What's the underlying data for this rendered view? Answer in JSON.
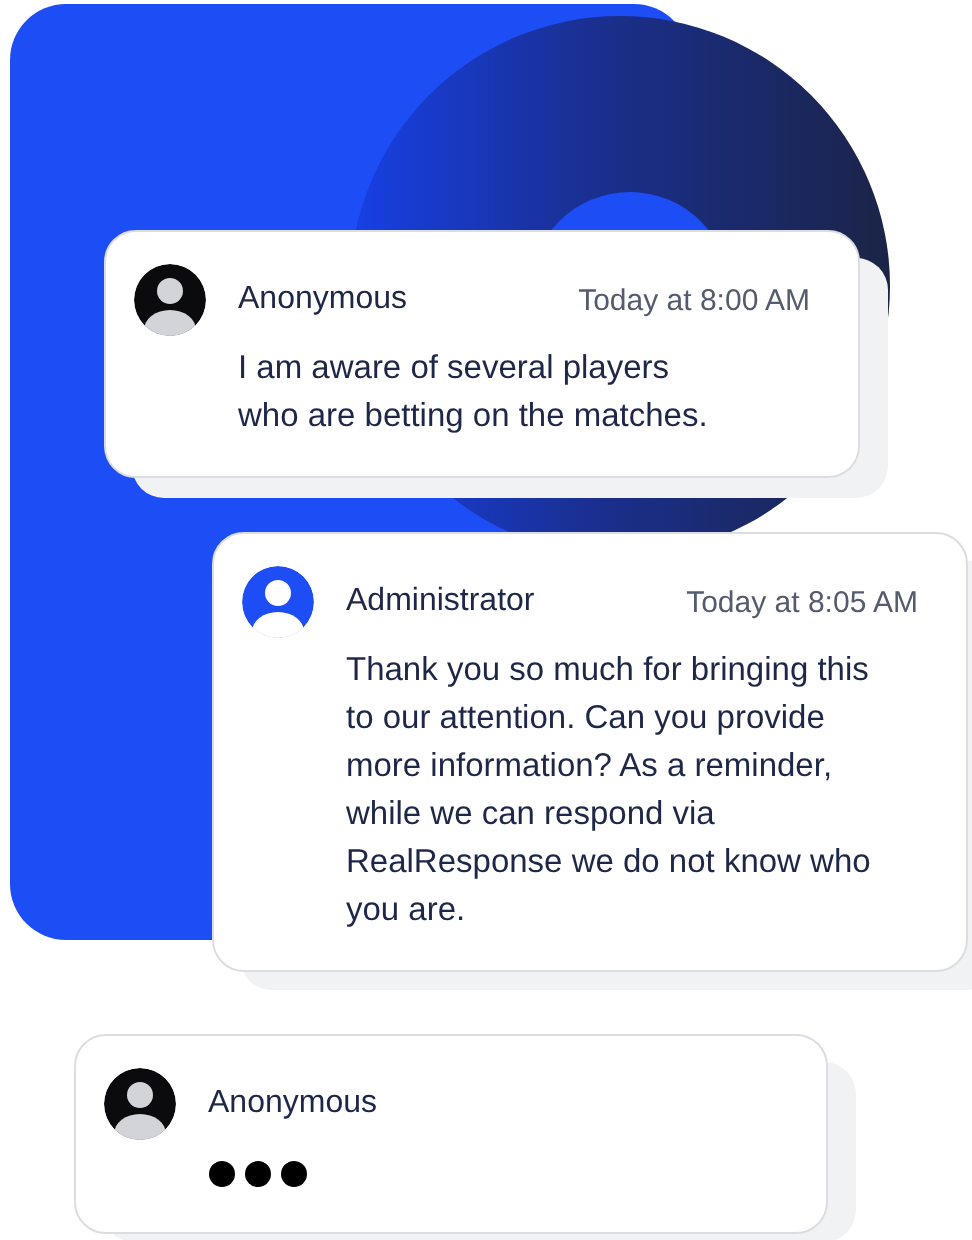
{
  "messages": [
    {
      "author": "Anonymous",
      "admin": false,
      "time": "Today at 8:00 AM",
      "kind": "text",
      "body": "I am aware of several players who are betting on the matches."
    },
    {
      "author": "Administrator",
      "admin": true,
      "time": "Today at 8:05 AM",
      "kind": "text",
      "body": "Thank you so much for bringing this to our attention. Can you provide more information? As a reminder, while we can respond via RealResponse we do not know who you are."
    },
    {
      "author": "Anonymous",
      "admin": false,
      "kind": "typing"
    }
  ]
}
